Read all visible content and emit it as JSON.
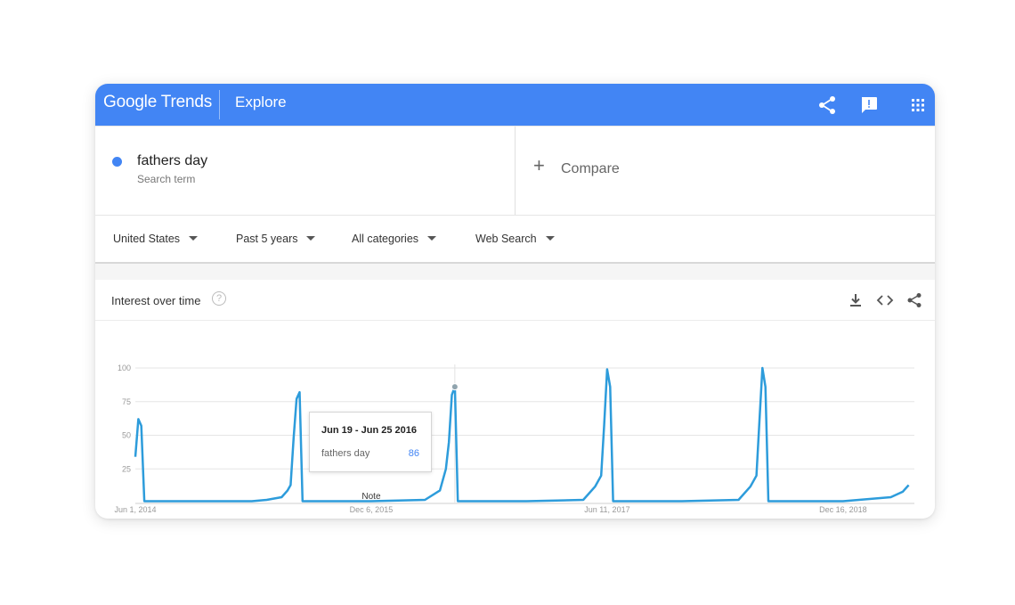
{
  "header": {
    "logo": "Google Trends",
    "section": "Explore",
    "icons": [
      "share-icon",
      "feedback-icon",
      "apps-icon"
    ]
  },
  "search": {
    "term": "fathers day",
    "term_type": "Search term",
    "term_color": "#4285f4",
    "compare_label": "Compare"
  },
  "filters": {
    "region": "United States",
    "time": "Past 5 years",
    "category": "All categories",
    "property": "Web Search"
  },
  "panel": {
    "title": "Interest over time",
    "help": "?",
    "icons": [
      "download-icon",
      "embed-icon",
      "share-icon"
    ]
  },
  "tooltip": {
    "date": "Jun 19 - Jun 25 2016",
    "term": "fathers day",
    "value": "86"
  },
  "note_label": "Note",
  "colors": {
    "brand": "#4285f4",
    "series": "#2d9cdb"
  },
  "chart_data": {
    "type": "line",
    "title": "Interest over time",
    "xlabel": "",
    "ylabel": "",
    "ylim": [
      0,
      100
    ],
    "yticks": [
      25,
      50,
      75,
      100
    ],
    "xticks": [
      "Jun 1, 2014",
      "Dec 6, 2015",
      "Jun 11, 2017",
      "Dec 16, 2018"
    ],
    "grid": true,
    "series": [
      {
        "name": "fathers day",
        "points": [
          [
            "2014-06-01",
            34
          ],
          [
            "2014-06-08",
            62
          ],
          [
            "2014-06-15",
            57
          ],
          [
            "2014-06-22",
            1
          ],
          [
            "2014-09-14",
            1
          ],
          [
            "2015-03-01",
            1
          ],
          [
            "2015-04-05",
            2
          ],
          [
            "2015-05-10",
            4
          ],
          [
            "2015-05-24",
            9
          ],
          [
            "2015-05-31",
            13
          ],
          [
            "2015-06-07",
            48
          ],
          [
            "2015-06-14",
            77
          ],
          [
            "2015-06-21",
            82
          ],
          [
            "2015-06-28",
            1
          ],
          [
            "2015-12-06",
            1
          ],
          [
            "2016-04-10",
            2
          ],
          [
            "2016-05-15",
            9
          ],
          [
            "2016-05-29",
            25
          ],
          [
            "2016-06-05",
            45
          ],
          [
            "2016-06-12",
            80
          ],
          [
            "2016-06-19",
            86
          ],
          [
            "2016-06-26",
            1
          ],
          [
            "2016-12-04",
            1
          ],
          [
            "2017-04-16",
            2
          ],
          [
            "2017-05-14",
            12
          ],
          [
            "2017-05-28",
            20
          ],
          [
            "2017-06-04",
            58
          ],
          [
            "2017-06-11",
            99
          ],
          [
            "2017-06-18",
            86
          ],
          [
            "2017-06-25",
            1
          ],
          [
            "2017-12-03",
            1
          ],
          [
            "2018-04-15",
            2
          ],
          [
            "2018-05-13",
            12
          ],
          [
            "2018-05-27",
            20
          ],
          [
            "2018-06-03",
            61
          ],
          [
            "2018-06-10",
            100
          ],
          [
            "2018-06-17",
            86
          ],
          [
            "2018-06-24",
            1
          ],
          [
            "2018-12-16",
            1
          ],
          [
            "2019-04-07",
            4
          ],
          [
            "2019-05-05",
            8
          ],
          [
            "2019-05-19",
            13
          ]
        ]
      }
    ]
  }
}
